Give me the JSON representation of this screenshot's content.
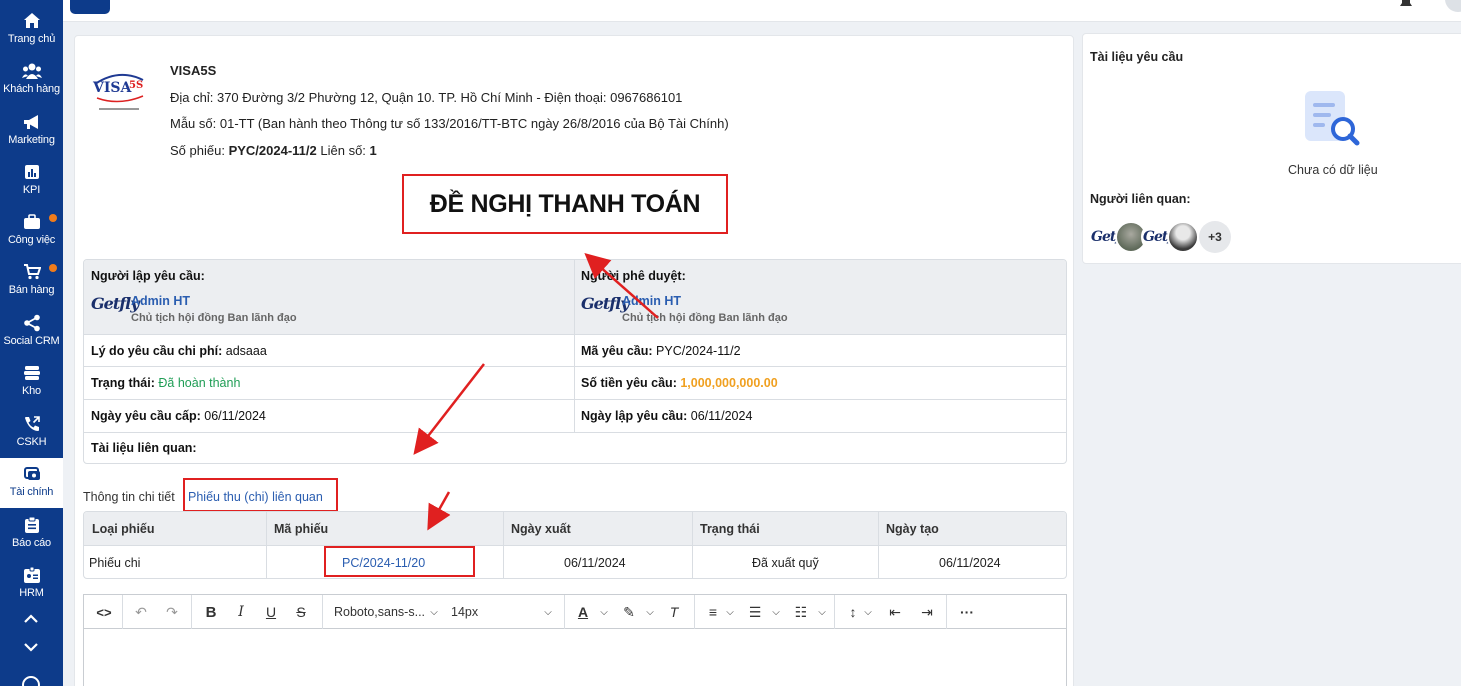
{
  "sidebar": {
    "items": [
      {
        "label": "Trang chủ",
        "icon": "home-icon"
      },
      {
        "label": "Khách hàng",
        "icon": "customers-icon"
      },
      {
        "label": "Marketing",
        "icon": "megaphone-icon"
      },
      {
        "label": "KPI",
        "icon": "chart-icon"
      },
      {
        "label": "Công việc",
        "icon": "briefcase-icon"
      },
      {
        "label": "Bán hàng",
        "icon": "cart-icon"
      },
      {
        "label": "Social CRM",
        "icon": "share-icon"
      },
      {
        "label": "Kho",
        "icon": "warehouse-icon"
      },
      {
        "label": "CSKH",
        "icon": "phone-icon"
      },
      {
        "label": "Tài chính",
        "icon": "finance-icon"
      },
      {
        "label": "Báo cáo",
        "icon": "clipboard-icon"
      },
      {
        "label": "HRM",
        "icon": "id-card-icon"
      }
    ]
  },
  "company": {
    "name": "VISA5S",
    "address": "Địa chỉ: 370 Đường 3/2 Phường 12, Quận 10. TP. Hồ Chí Minh - Điện thoại: 0967686101",
    "template": "Mẫu số: 01-TT (Ban hành theo Thông tư số 133/2016/TT-BTC ngày 26/8/2016 của Bộ Tài Chính)",
    "voucher_prefix": "Số phiếu:",
    "voucher_no": "PYC/2024-11/2",
    "copy_prefix": "Liên số:",
    "copy_no": "1",
    "logo_text": "VISA5S"
  },
  "document_title": "ĐỀ NGHỊ THANH TOÁN",
  "info": {
    "requester_label": "Người lập yêu cầu:",
    "requester_name": "Admin HT",
    "requester_role": "Chủ tịch hội đồng Ban lãnh đạo",
    "approver_label": "Người phê duyệt:",
    "approver_name": "Admin HT",
    "approver_role": "Chủ tịch hội đồng Ban lãnh đạo",
    "logo_text": "Getfly",
    "reason_label": "Lý do yêu cầu chi phí:",
    "reason_value": "adsaaa",
    "code_label": "Mã yêu cầu:",
    "code_value": "PYC/2024-11/2",
    "status_label": "Trạng thái:",
    "status_value": "Đã hoàn thành",
    "amount_label": "Số tiền yêu cầu:",
    "amount_value": "1,000,000,000.00",
    "req_date_label": "Ngày yêu cầu cấp:",
    "req_date_value": "06/11/2024",
    "created_date_label": "Ngày lập yêu cầu:",
    "created_date_value": "06/11/2024",
    "attachments_label": "Tài liệu liên quan:"
  },
  "tabs": {
    "detail": "Thông tin chi tiết",
    "related": "Phiếu thu (chi) liên quan"
  },
  "vouchers": {
    "columns": [
      "Loại phiếu",
      "Mã phiếu",
      "Ngày xuất",
      "Trạng thái",
      "Ngày tạo"
    ],
    "rows": [
      {
        "type": "Phiếu chi",
        "code": "PC/2024-11/20",
        "export_date": "06/11/2024",
        "status": "Đã xuất quỹ",
        "created": "06/11/2024"
      }
    ]
  },
  "editor": {
    "font": "Roboto,sans-s...",
    "size": "14px"
  },
  "side_panel": {
    "title": "Tài liệu yêu cầu",
    "empty": "Chưa có dữ liệu",
    "related_people": "Người liên quan:",
    "more": "+3",
    "avatar_text": "Getfly"
  },
  "colors": {
    "sidebar": "#0d3b8a",
    "annotation": "#e02020",
    "status_green": "#1f9d55",
    "amount_orange": "#f0a020",
    "link": "#2a5db0"
  }
}
